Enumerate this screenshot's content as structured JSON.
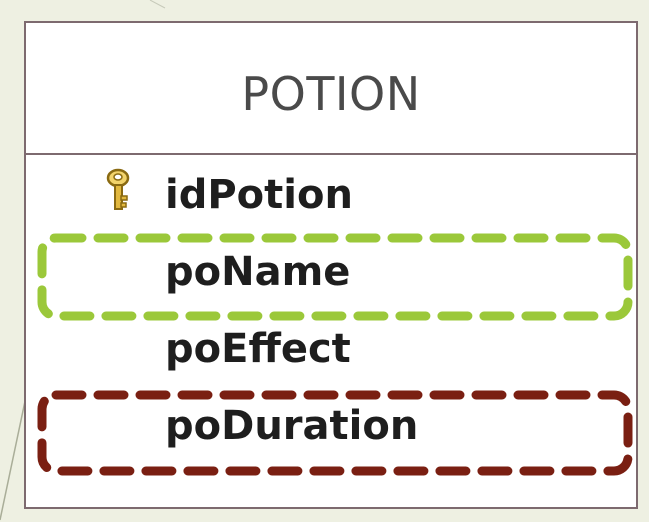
{
  "entity": {
    "name": "POTION",
    "primary_key_icon": "key-icon",
    "fields": [
      {
        "name": "idPotion",
        "primary_key": true
      },
      {
        "name": "poName",
        "highlight": "green"
      },
      {
        "name": "poEffect"
      },
      {
        "name": "poDuration",
        "highlight": "dark-red"
      }
    ]
  },
  "colors": {
    "background": "#eef0e2",
    "border": "#7d6a6f",
    "green_highlight": "#9bc83a",
    "red_highlight": "#7a1f12",
    "key_gold": "#c9a227"
  }
}
